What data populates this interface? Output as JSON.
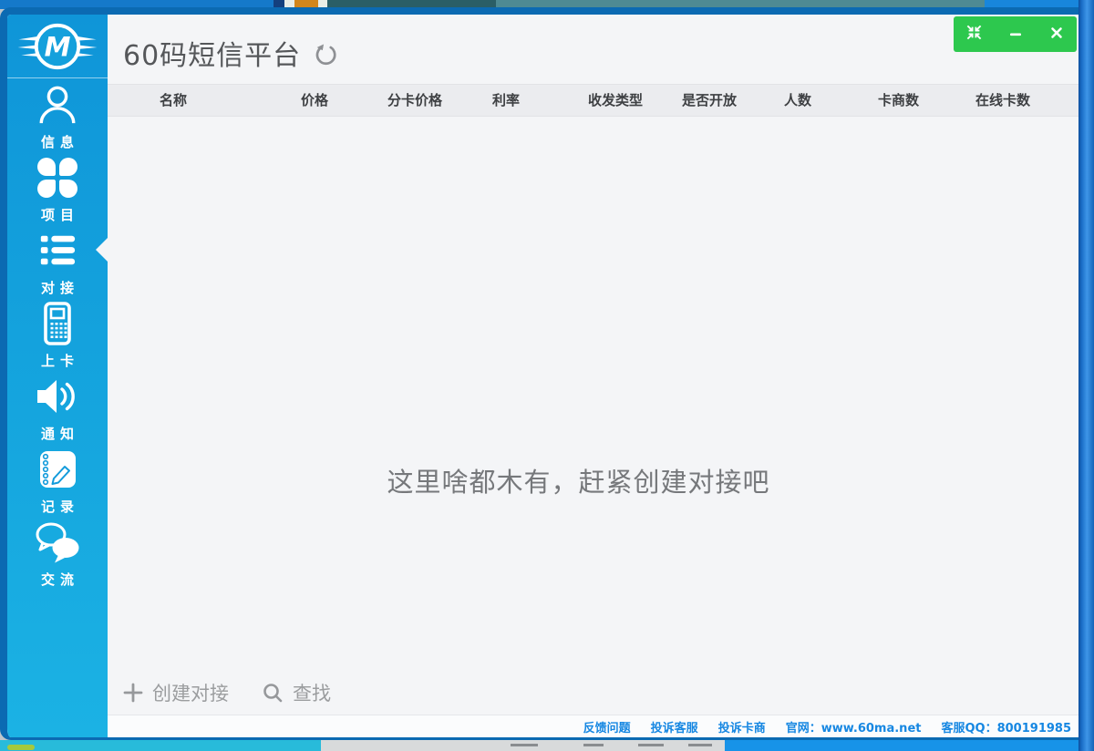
{
  "app": {
    "title": "60码短信平台",
    "logo": "winged-m-logo",
    "logo_letter": "M"
  },
  "window_controls": [
    {
      "id": "shrink",
      "icon": "shrink-icon"
    },
    {
      "id": "minimize",
      "icon": "minimize-icon"
    },
    {
      "id": "close",
      "icon": "close-icon"
    }
  ],
  "sidebar": {
    "items": [
      {
        "id": "info",
        "label": "信息",
        "icon": "user-icon",
        "active": false
      },
      {
        "id": "projects",
        "label": "项目",
        "icon": "clover-grid-icon",
        "active": false
      },
      {
        "id": "docking",
        "label": "对接",
        "icon": "list-icon",
        "active": true
      },
      {
        "id": "upload-card",
        "label": "上卡",
        "icon": "phone-icon",
        "active": false
      },
      {
        "id": "notifications",
        "label": "通知",
        "icon": "speaker-icon",
        "active": false
      },
      {
        "id": "records",
        "label": "记录",
        "icon": "notebook-pencil-icon",
        "active": false
      },
      {
        "id": "chat",
        "label": "交流",
        "icon": "chat-bubbles-icon",
        "active": false
      }
    ]
  },
  "table": {
    "columns": [
      "名称",
      "价格",
      "分卡价格",
      "利率",
      "收发类型",
      "是否开放",
      "人数",
      "卡商数",
      "在线卡数"
    ],
    "rows": [],
    "empty_message": "这里啥都木有，赶紧创建对接吧"
  },
  "actions": {
    "create_label": "创建对接",
    "search_label": "查找"
  },
  "footer": {
    "links": [
      "反馈问题",
      "投诉客服",
      "投诉卡商"
    ],
    "site_label": "官网：www.60ma.net",
    "qq_label": "客服QQ：800191985"
  },
  "colors": {
    "sidebar_blue": "#14A0DC",
    "border_blue": "#0B6AB2",
    "controls_green": "#2DC84E",
    "link_blue": "#1687E2",
    "content_bg": "#F4F5F7",
    "title_gray": "#55575A"
  }
}
